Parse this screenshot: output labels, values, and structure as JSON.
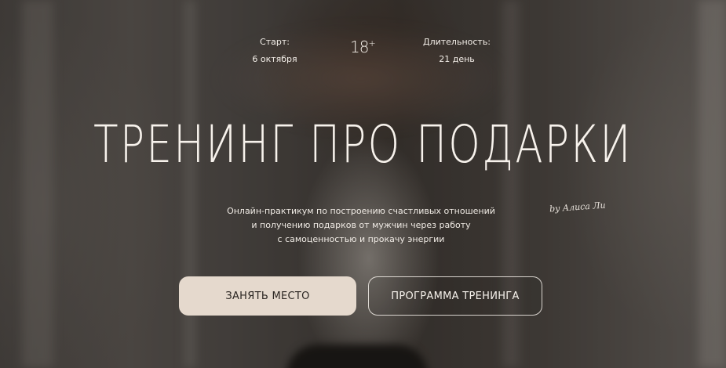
{
  "info": {
    "start_label": "Старт:",
    "start_value": "6 октября",
    "age_main": "18",
    "age_plus": "+",
    "duration_label": "Длительность:",
    "duration_value": "21 день"
  },
  "hero": {
    "title": "ТРЕНИНГ ПРО ПОДАРКИ",
    "signature": "by Алиса Ли",
    "subtitle_lines": [
      "Онлайн-практикум по построению счастливых отношений",
      "и получению подарков от мужчин через работу",
      "с самоценностью и прокачу энергии"
    ]
  },
  "buttons": {
    "primary": "ЗАНЯТЬ МЕСТО",
    "secondary": "ПРОГРАММА ТРЕНИНГА"
  },
  "colors": {
    "primary_button_bg": "#e5d9cd",
    "text_light": "#f4efe9",
    "primary_button_text": "#2b2622"
  }
}
